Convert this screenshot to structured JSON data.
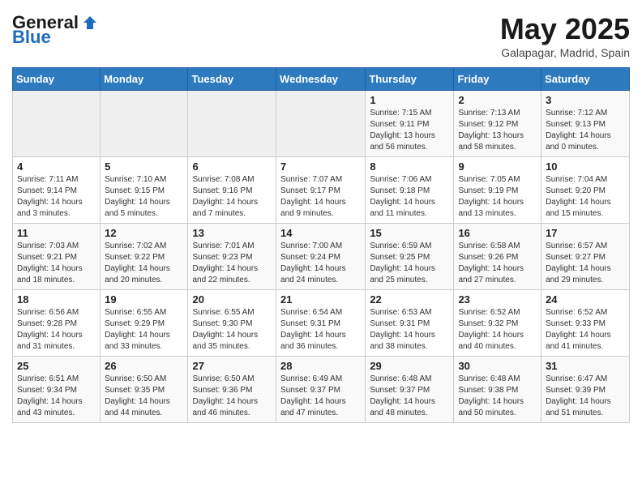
{
  "header": {
    "logo_general": "General",
    "logo_blue": "Blue",
    "month_title": "May 2025",
    "location": "Galapagar, Madrid, Spain"
  },
  "days_of_week": [
    "Sunday",
    "Monday",
    "Tuesday",
    "Wednesday",
    "Thursday",
    "Friday",
    "Saturday"
  ],
  "weeks": [
    [
      {
        "day": "",
        "info": ""
      },
      {
        "day": "",
        "info": ""
      },
      {
        "day": "",
        "info": ""
      },
      {
        "day": "",
        "info": ""
      },
      {
        "day": "1",
        "info": "Sunrise: 7:15 AM\nSunset: 9:11 PM\nDaylight: 13 hours\nand 56 minutes."
      },
      {
        "day": "2",
        "info": "Sunrise: 7:13 AM\nSunset: 9:12 PM\nDaylight: 13 hours\nand 58 minutes."
      },
      {
        "day": "3",
        "info": "Sunrise: 7:12 AM\nSunset: 9:13 PM\nDaylight: 14 hours\nand 0 minutes."
      }
    ],
    [
      {
        "day": "4",
        "info": "Sunrise: 7:11 AM\nSunset: 9:14 PM\nDaylight: 14 hours\nand 3 minutes."
      },
      {
        "day": "5",
        "info": "Sunrise: 7:10 AM\nSunset: 9:15 PM\nDaylight: 14 hours\nand 5 minutes."
      },
      {
        "day": "6",
        "info": "Sunrise: 7:08 AM\nSunset: 9:16 PM\nDaylight: 14 hours\nand 7 minutes."
      },
      {
        "day": "7",
        "info": "Sunrise: 7:07 AM\nSunset: 9:17 PM\nDaylight: 14 hours\nand 9 minutes."
      },
      {
        "day": "8",
        "info": "Sunrise: 7:06 AM\nSunset: 9:18 PM\nDaylight: 14 hours\nand 11 minutes."
      },
      {
        "day": "9",
        "info": "Sunrise: 7:05 AM\nSunset: 9:19 PM\nDaylight: 14 hours\nand 13 minutes."
      },
      {
        "day": "10",
        "info": "Sunrise: 7:04 AM\nSunset: 9:20 PM\nDaylight: 14 hours\nand 15 minutes."
      }
    ],
    [
      {
        "day": "11",
        "info": "Sunrise: 7:03 AM\nSunset: 9:21 PM\nDaylight: 14 hours\nand 18 minutes."
      },
      {
        "day": "12",
        "info": "Sunrise: 7:02 AM\nSunset: 9:22 PM\nDaylight: 14 hours\nand 20 minutes."
      },
      {
        "day": "13",
        "info": "Sunrise: 7:01 AM\nSunset: 9:23 PM\nDaylight: 14 hours\nand 22 minutes."
      },
      {
        "day": "14",
        "info": "Sunrise: 7:00 AM\nSunset: 9:24 PM\nDaylight: 14 hours\nand 24 minutes."
      },
      {
        "day": "15",
        "info": "Sunrise: 6:59 AM\nSunset: 9:25 PM\nDaylight: 14 hours\nand 25 minutes."
      },
      {
        "day": "16",
        "info": "Sunrise: 6:58 AM\nSunset: 9:26 PM\nDaylight: 14 hours\nand 27 minutes."
      },
      {
        "day": "17",
        "info": "Sunrise: 6:57 AM\nSunset: 9:27 PM\nDaylight: 14 hours\nand 29 minutes."
      }
    ],
    [
      {
        "day": "18",
        "info": "Sunrise: 6:56 AM\nSunset: 9:28 PM\nDaylight: 14 hours\nand 31 minutes."
      },
      {
        "day": "19",
        "info": "Sunrise: 6:55 AM\nSunset: 9:29 PM\nDaylight: 14 hours\nand 33 minutes."
      },
      {
        "day": "20",
        "info": "Sunrise: 6:55 AM\nSunset: 9:30 PM\nDaylight: 14 hours\nand 35 minutes."
      },
      {
        "day": "21",
        "info": "Sunrise: 6:54 AM\nSunset: 9:31 PM\nDaylight: 14 hours\nand 36 minutes."
      },
      {
        "day": "22",
        "info": "Sunrise: 6:53 AM\nSunset: 9:31 PM\nDaylight: 14 hours\nand 38 minutes."
      },
      {
        "day": "23",
        "info": "Sunrise: 6:52 AM\nSunset: 9:32 PM\nDaylight: 14 hours\nand 40 minutes."
      },
      {
        "day": "24",
        "info": "Sunrise: 6:52 AM\nSunset: 9:33 PM\nDaylight: 14 hours\nand 41 minutes."
      }
    ],
    [
      {
        "day": "25",
        "info": "Sunrise: 6:51 AM\nSunset: 9:34 PM\nDaylight: 14 hours\nand 43 minutes."
      },
      {
        "day": "26",
        "info": "Sunrise: 6:50 AM\nSunset: 9:35 PM\nDaylight: 14 hours\nand 44 minutes."
      },
      {
        "day": "27",
        "info": "Sunrise: 6:50 AM\nSunset: 9:36 PM\nDaylight: 14 hours\nand 46 minutes."
      },
      {
        "day": "28",
        "info": "Sunrise: 6:49 AM\nSunset: 9:37 PM\nDaylight: 14 hours\nand 47 minutes."
      },
      {
        "day": "29",
        "info": "Sunrise: 6:48 AM\nSunset: 9:37 PM\nDaylight: 14 hours\nand 48 minutes."
      },
      {
        "day": "30",
        "info": "Sunrise: 6:48 AM\nSunset: 9:38 PM\nDaylight: 14 hours\nand 50 minutes."
      },
      {
        "day": "31",
        "info": "Sunrise: 6:47 AM\nSunset: 9:39 PM\nDaylight: 14 hours\nand 51 minutes."
      }
    ]
  ]
}
